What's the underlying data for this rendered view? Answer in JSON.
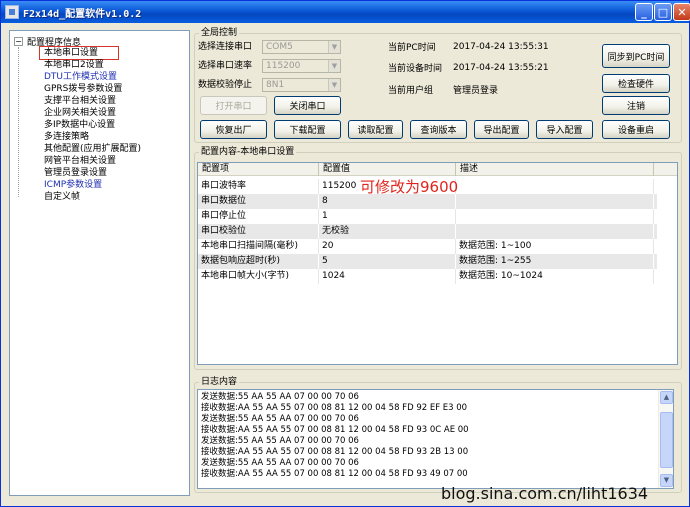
{
  "window": {
    "title": "F2x14d_配置软件v1.0.2"
  },
  "tree": {
    "root_label": "配置程序信息",
    "items": [
      {
        "label": "本地串口设置",
        "selected": true,
        "color": "#000000"
      },
      {
        "label": "本地串口2设置",
        "color": "#000000"
      },
      {
        "label": "DTU工作模式设置",
        "color": "#1f2fb0"
      },
      {
        "label": "GPRS拨号参数设置",
        "color": "#000000"
      },
      {
        "label": "支撑平台相关设置",
        "color": "#000000"
      },
      {
        "label": "企业网关相关设置",
        "color": "#000000"
      },
      {
        "label": "多IP数据中心设置",
        "color": "#000000"
      },
      {
        "label": "多连接策略",
        "color": "#000000"
      },
      {
        "label": "其他配置(应用扩展配置)",
        "color": "#000000"
      },
      {
        "label": "网管平台相关设置",
        "color": "#000000"
      },
      {
        "label": "管理员登录设置",
        "color": "#000000"
      },
      {
        "label": "ICMP参数设置",
        "color": "#1f2fb0"
      },
      {
        "label": "自定义帧",
        "color": "#000000"
      }
    ]
  },
  "global_control": {
    "group_label": "全局控制",
    "port_label": "选择连接串口",
    "port_value": "COM5",
    "baud_label": "选择串口速率",
    "baud_value": "115200",
    "parity_label": "数据校验停止",
    "parity_value": "8N1",
    "pc_time_label": "当前PC时间",
    "pc_time_value": "2017-04-24 13:55:31",
    "device_time_label": "当前设备时间",
    "device_time_value": "2017-04-24 13:55:21",
    "user_label": "当前用户组",
    "user_value": "管理员登录",
    "open_port_button": "打开串口",
    "close_port_button": "关闭串口",
    "sync_pc_time_button": "同步到PC时间",
    "check_hardware_button": "检查硬件",
    "logout_button": "注销",
    "factory_reset_button": "恢复出厂",
    "download_config_button": "下载配置",
    "read_config_button": "读取配置",
    "query_version_button": "查询版本",
    "export_config_button": "导出配置",
    "import_config_button": "导入配置",
    "restart_device_button": "设备重启"
  },
  "config_content": {
    "group_label": "配置内容-本地串口设置",
    "columns": [
      "配置项",
      "配置值",
      "描述"
    ],
    "rows": [
      {
        "item": "串口波特率",
        "value": "115200",
        "desc": ""
      },
      {
        "item": "串口数据位",
        "value": "8",
        "desc": ""
      },
      {
        "item": "串口停止位",
        "value": "1",
        "desc": ""
      },
      {
        "item": "串口校验位",
        "value": "无校验",
        "desc": ""
      },
      {
        "item": "本地串口扫描间隔(毫秒)",
        "value": "20",
        "desc": "数据范围: 1~100"
      },
      {
        "item": "数据包响应超时(秒)",
        "value": "5",
        "desc": "数据范围: 1~255"
      },
      {
        "item": "本地串口帧大小(字节)",
        "value": "1024",
        "desc": "数据范围: 10~1024"
      }
    ],
    "annotation": "可修改为9600"
  },
  "log": {
    "group_label": "日志内容",
    "lines": [
      "发送数据:55 AA 55 AA 07 00 00 70 06",
      "接收数据:AA 55 AA 55 07 00 08 81 12 00 04 58 FD 92 EF E3 00",
      "发送数据:55 AA 55 AA 07 00 00 70 06",
      "接收数据:AA 55 AA 55 07 00 08 81 12 00 04 58 FD 93 0C AE 00",
      "发送数据:55 AA 55 AA 07 00 00 70 06",
      "接收数据:AA 55 AA 55 07 00 08 81 12 00 04 58 FD 93 2B 13 00",
      "发送数据:55 AA 55 AA 07 00 00 70 06",
      "接收数据:AA 55 AA 55 07 00 08 81 12 00 04 58 FD 93 49 07 00"
    ]
  },
  "watermark": "blog.sina.com.cn/liht1634"
}
